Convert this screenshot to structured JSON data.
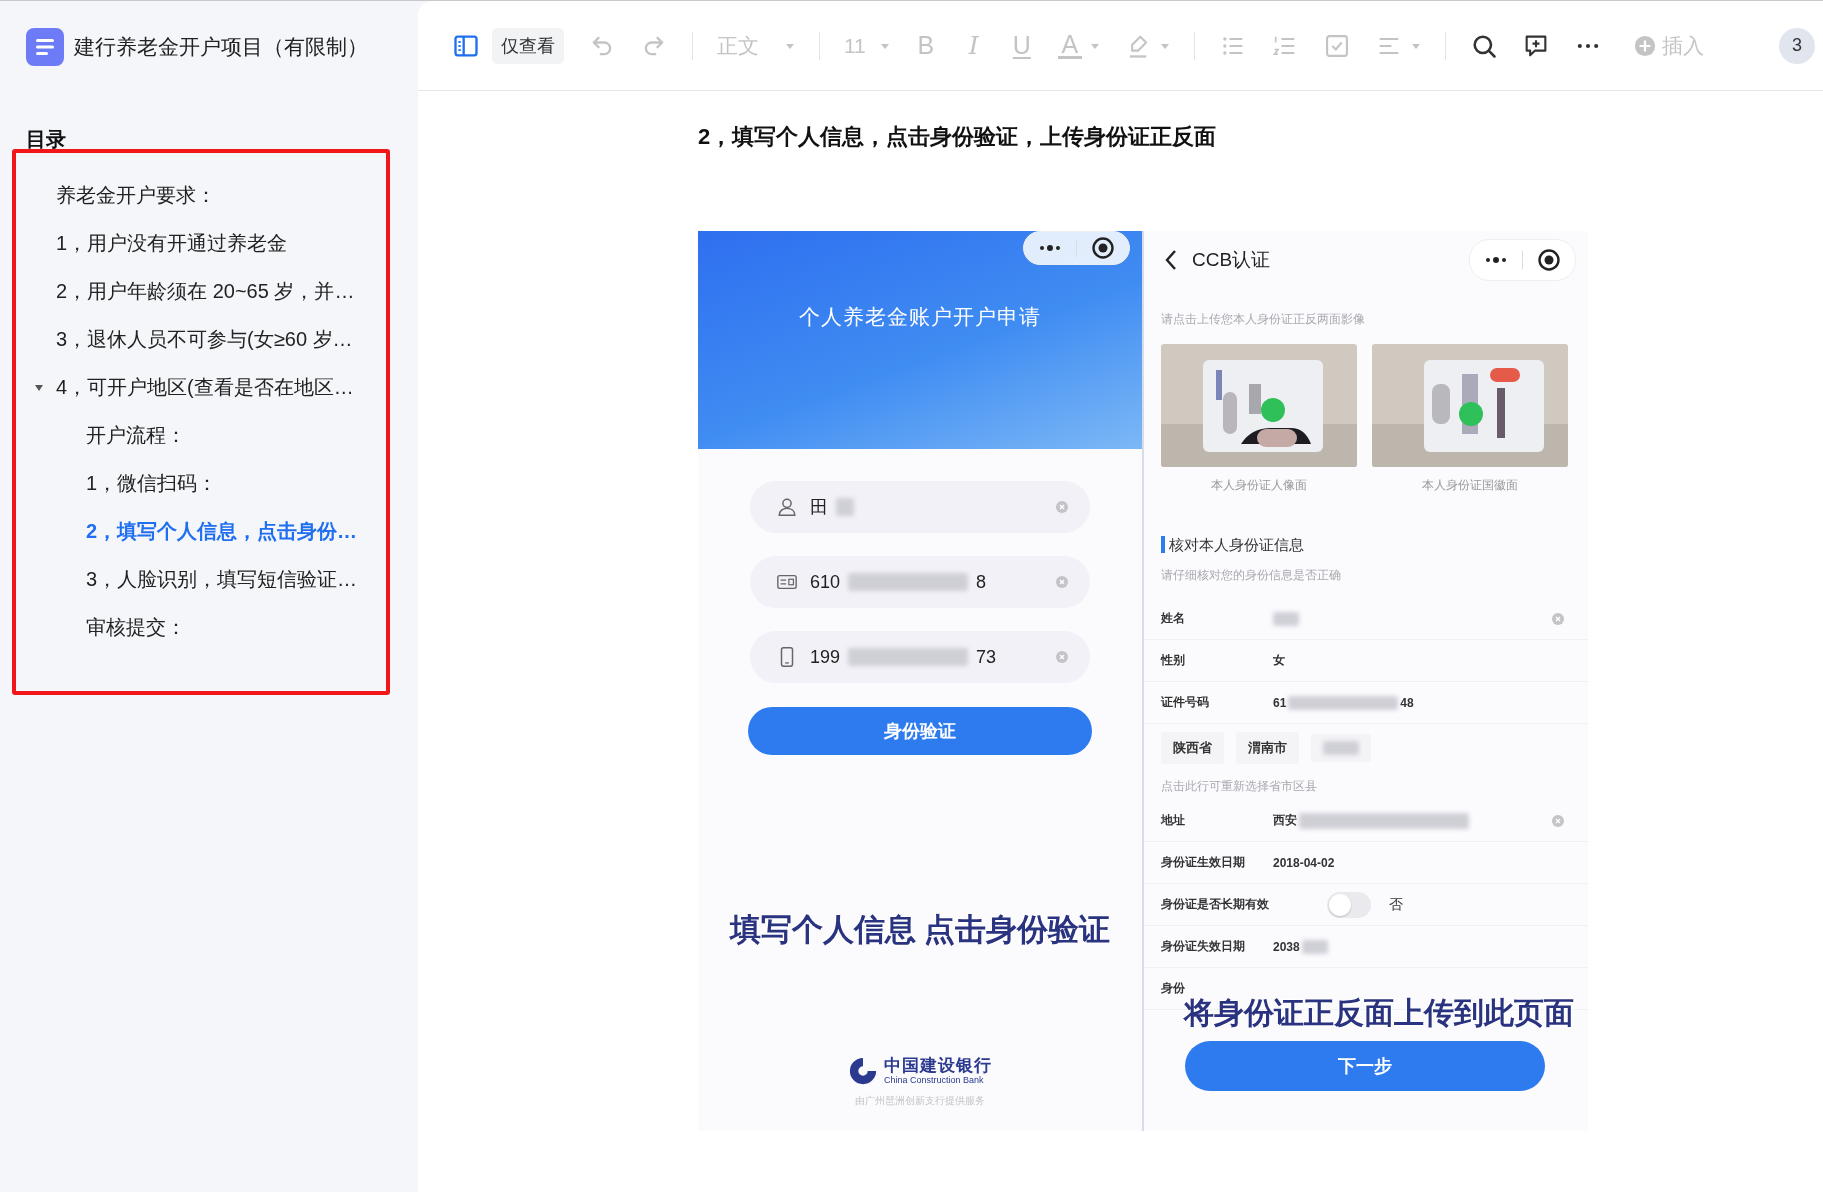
{
  "document": {
    "title": "建行养老金开户项目（有限制）"
  },
  "outline": {
    "title": "目录",
    "highlighted": true,
    "items": [
      {
        "text": "养老金开户要求：",
        "selected": false
      },
      {
        "text": "1，用户没有开通过养老金",
        "selected": false
      },
      {
        "text": "2，用户年龄须在 20~65 岁，并…",
        "selected": false
      },
      {
        "text": "3，退休人员不可参与(女≥60 岁…",
        "selected": false
      },
      {
        "text": "4，可开户地区(查看是否在地区…",
        "selected": false,
        "expanded": true,
        "children": [
          {
            "text": "开户流程：",
            "selected": false
          },
          {
            "text": "1，微信扫码：",
            "selected": false
          },
          {
            "text": "2，填写个人信息，点击身份…",
            "selected": true
          },
          {
            "text": "3，人脸识别，填写短信验证…",
            "selected": false
          },
          {
            "text": "审核提交：",
            "selected": false
          }
        ]
      }
    ]
  },
  "toolbar": [
    {
      "kind": "toggle",
      "on": true
    },
    {
      "kind": "mode",
      "label": "仅查看"
    },
    {
      "kind": "undo",
      "disabled": true
    },
    {
      "kind": "redo",
      "disabled": true
    },
    {
      "kind": "divider"
    },
    {
      "kind": "style",
      "label": "正文",
      "disabled": true
    },
    {
      "kind": "divider"
    },
    {
      "kind": "size",
      "label": "11",
      "disabled": true
    },
    {
      "kind": "bold",
      "glyph": "B",
      "disabled": true
    },
    {
      "kind": "italic",
      "glyph": "I",
      "disabled": true
    },
    {
      "kind": "underline",
      "glyph": "U",
      "disabled": true
    },
    {
      "kind": "color",
      "glyph": "A",
      "disabled": true
    },
    {
      "kind": "highlight",
      "disabled": true
    },
    {
      "kind": "divider"
    },
    {
      "kind": "bullets",
      "disabled": true
    },
    {
      "kind": "numbering",
      "disabled": true
    },
    {
      "kind": "task",
      "disabled": true
    },
    {
      "kind": "align",
      "disabled": true
    },
    {
      "kind": "divider"
    },
    {
      "kind": "search",
      "disabled": false
    },
    {
      "kind": "comment",
      "disabled": false
    },
    {
      "kind": "more",
      "disabled": false
    },
    {
      "kind": "insert",
      "label": "插入",
      "disabled": true
    },
    {
      "kind": "members",
      "count": "3"
    }
  ],
  "content": {
    "heading": "2，填写个人信息，点击身份验证，上传身份证正反面",
    "form_screen": {
      "title": "个人养老金账户开户申请",
      "fields": [
        {
          "kind": "name",
          "start": "田",
          "blurred": true
        },
        {
          "kind": "id",
          "start": "610",
          "end": "8",
          "blurred": true
        },
        {
          "kind": "phone",
          "start": "199",
          "end": "73",
          "blurred": true
        }
      ],
      "button": "身份验证",
      "caption": "填写个人信息 点击身份验证",
      "bank_name": "中国建设银行",
      "bank_name_en": "China Construction Bank",
      "footer": "由广州琶洲创新支行提供服务"
    },
    "verify_screen": {
      "title": "CCB认证",
      "upload_hint": "请点击上传您本人身份证正反两面影像",
      "photos": [
        {
          "kind": "picture",
          "caption": "本人身份证人像面"
        },
        {
          "kind": "picture",
          "caption": "本人身份证国徽面"
        }
      ],
      "section_title": "核对本人身份证信息",
      "section_hint": "请仔细核对您的身份信息是否正确",
      "rows": [
        {
          "kind": "field",
          "label": "姓名",
          "blurred": true,
          "clearable": true
        },
        {
          "kind": "field",
          "label": "性别",
          "value": "女"
        },
        {
          "kind": "field",
          "label": "证件号码",
          "value": "61",
          "value_end": "48",
          "blurred": true
        },
        {
          "kind": "chips",
          "chips": [
            "陕西省",
            "渭南市"
          ],
          "blurred": true
        },
        {
          "kind": "hint",
          "text": "点击此行可重新选择省市区县"
        },
        {
          "kind": "field",
          "label": "地址",
          "value": "西安",
          "blurred": true,
          "clearable": true
        },
        {
          "kind": "field",
          "label": "身份证生效日期",
          "value": "2018-04-02"
        },
        {
          "kind": "switch",
          "label": "身份证是否长期有效",
          "on": false,
          "value": "否"
        },
        {
          "kind": "field",
          "label": "身份证失效日期",
          "value": "2038",
          "blurred": true
        },
        {
          "kind": "field",
          "label": "身份"
        }
      ],
      "caption": "将身份证正反面上传到此页面",
      "button": "下一步"
    }
  }
}
